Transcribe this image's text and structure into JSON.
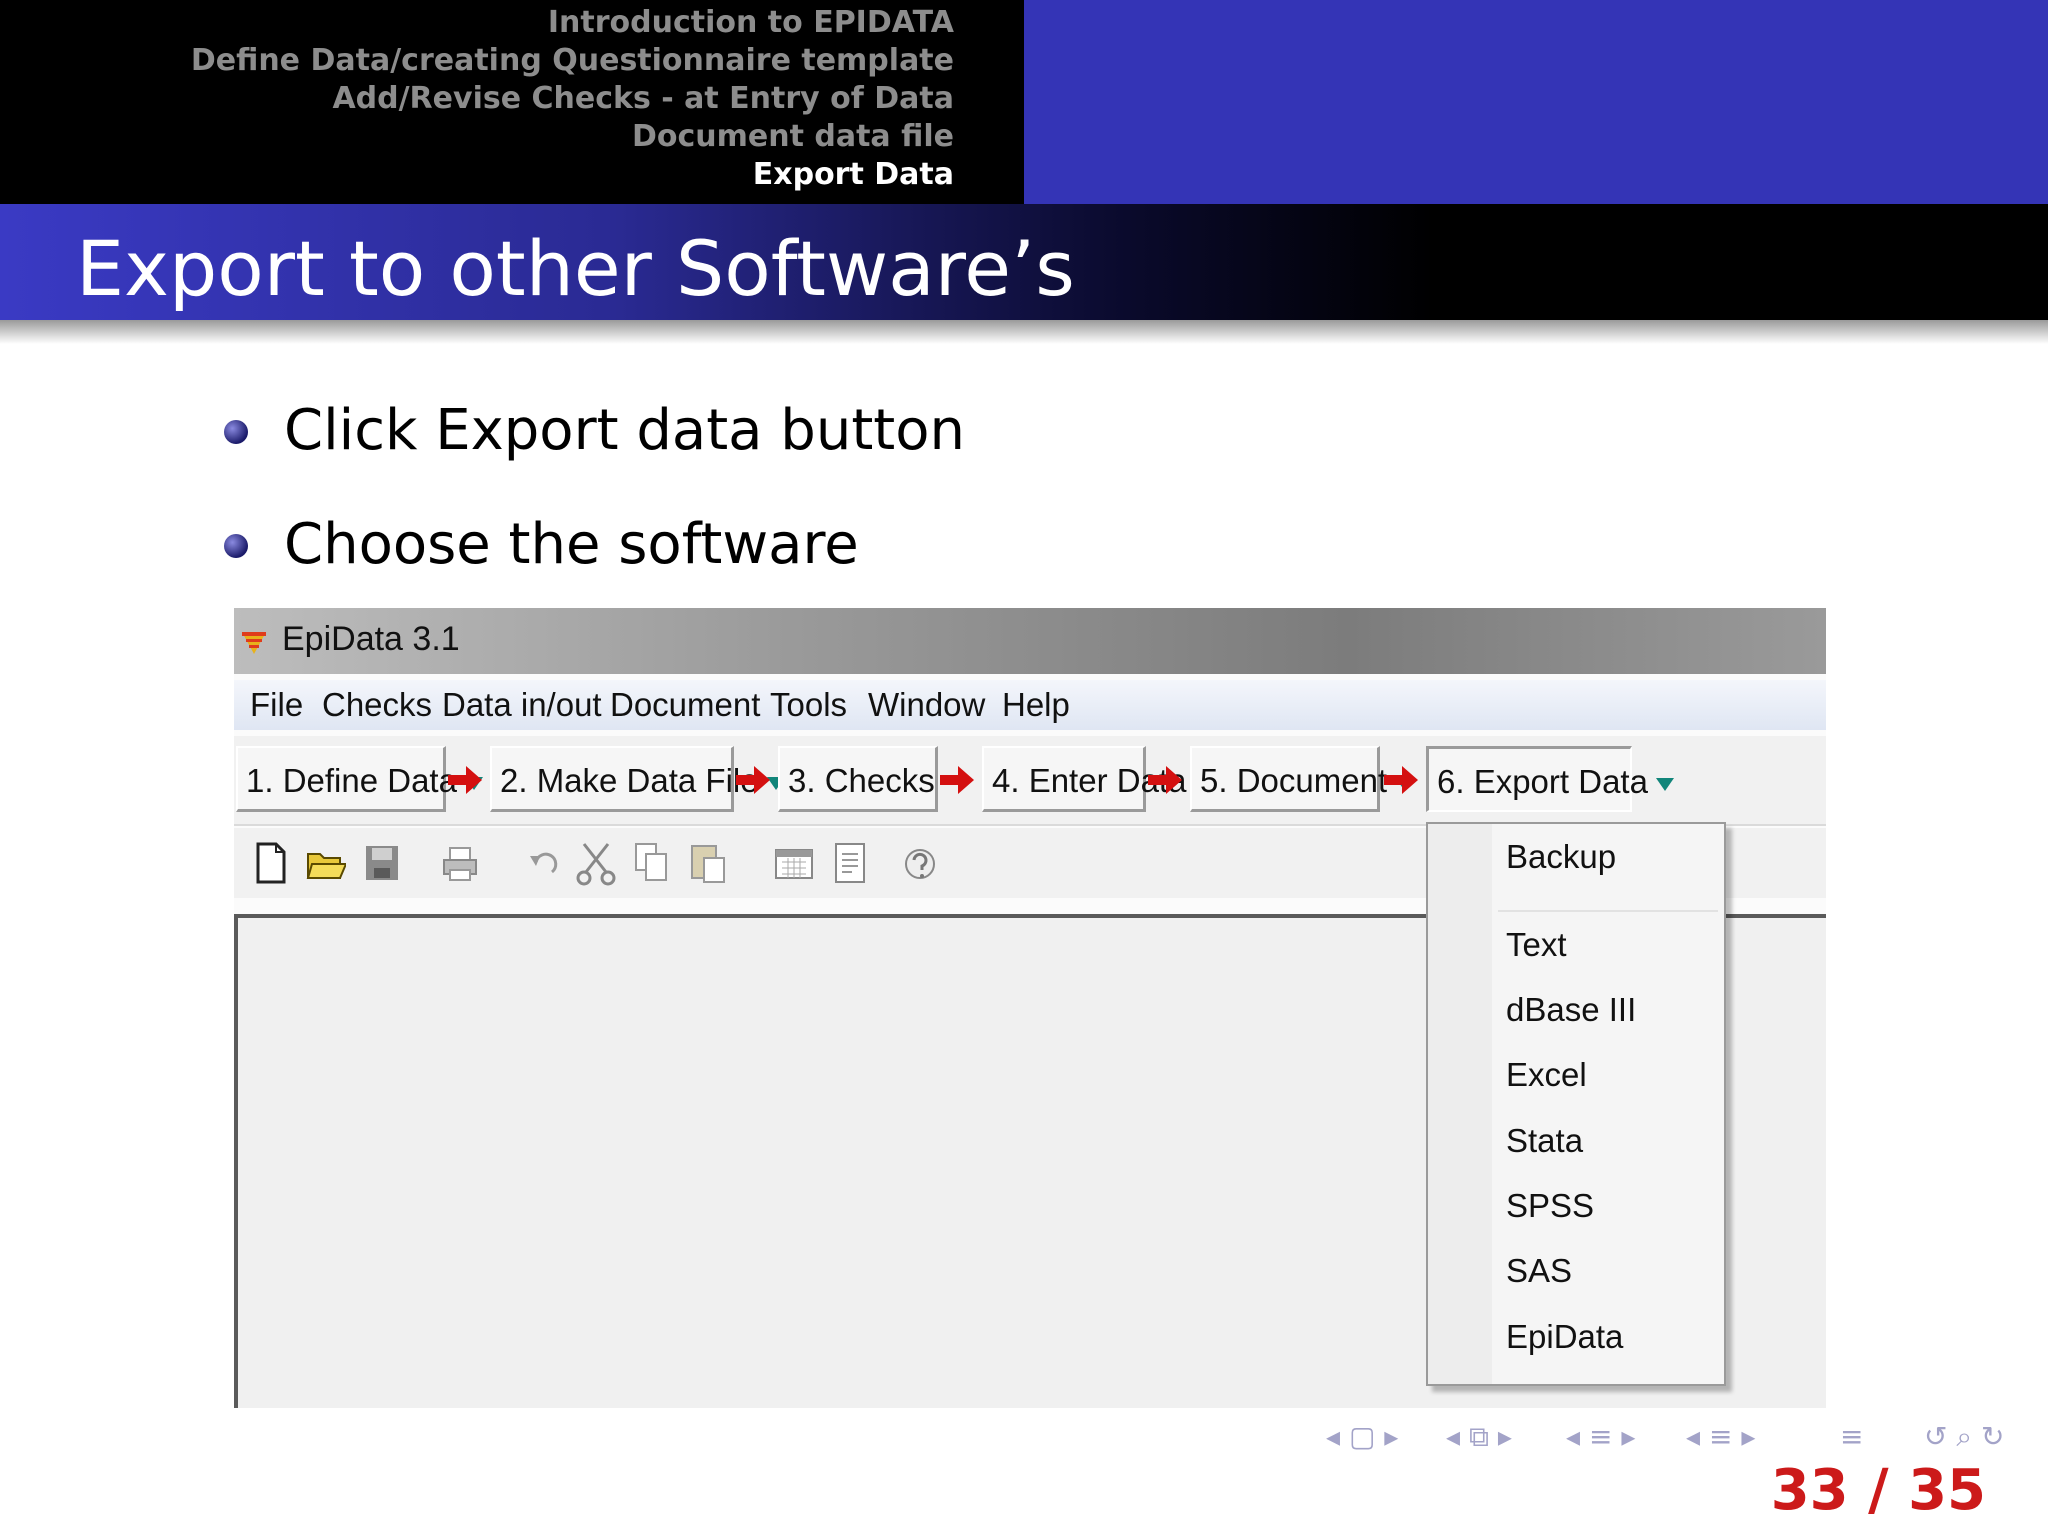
{
  "navigation": {
    "sections": [
      "Introduction to EPIDATA",
      "Define Data/creating Questionnaire template",
      "Add/Revise Checks - at Entry of Data",
      "Document data file",
      "Export Data"
    ],
    "active_index": 4
  },
  "slide": {
    "title": "Export to other Software’s",
    "bullets": [
      "Click Export data button",
      "Choose the software"
    ]
  },
  "epidata": {
    "title": "EpiData 3.1",
    "menu": [
      "File",
      "Checks",
      "Data in/out",
      "Document",
      "Tools",
      "Window",
      "Help"
    ],
    "workflow": [
      {
        "label": "1. Define Data",
        "has_dropdown": true
      },
      {
        "label": "2. Make Data File",
        "has_dropdown": true
      },
      {
        "label": "3. Checks",
        "has_dropdown": false
      },
      {
        "label": "4. Enter Data",
        "has_dropdown": false
      },
      {
        "label": "5. Document",
        "has_dropdown": true
      },
      {
        "label": "6. Export Data",
        "has_dropdown": true
      }
    ],
    "toolbar_icons": [
      "new-file-icon",
      "open-folder-icon",
      "save-icon",
      "print-icon",
      "undo-icon",
      "cut-icon",
      "copy-icon",
      "paste-icon",
      "calendar-icon",
      "document-icon",
      "help-icon"
    ],
    "export_menu": [
      "Backup",
      "Text",
      "dBase III",
      "Excel",
      "Stata",
      "SPSS",
      "SAS",
      "EpiData"
    ]
  },
  "footer": {
    "page": "33 / 35"
  },
  "colors": {
    "header_blue": "#3434b6",
    "page_number": "#cc1a1a",
    "dropdown_arrow": "#11857a",
    "workflow_arrow": "#d41010"
  }
}
